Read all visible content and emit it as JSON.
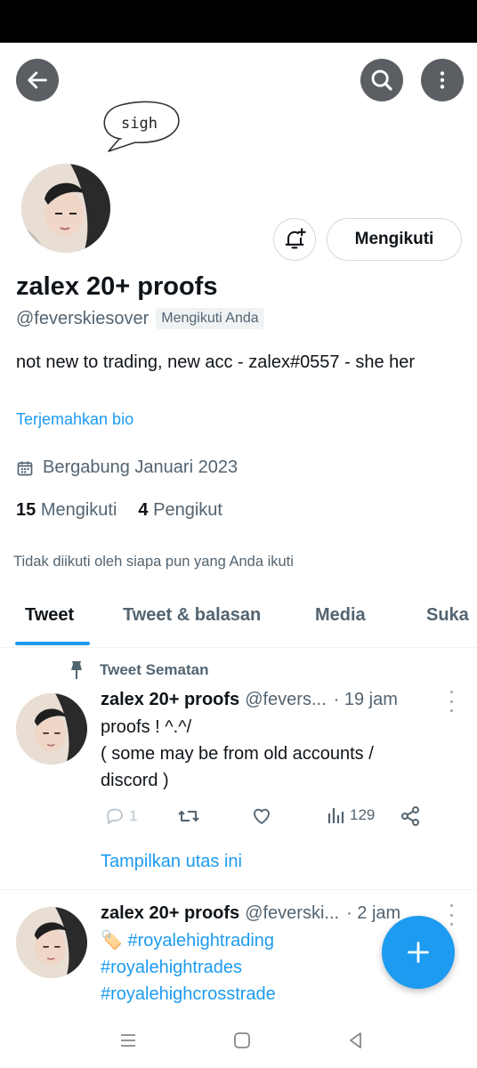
{
  "header": {
    "back_icon": "arrow-left-icon",
    "search_icon": "search-icon",
    "more_icon": "more-vertical-icon"
  },
  "profile": {
    "bubble_text": "sigh",
    "display_name": "zalex 20+ proofs",
    "handle": "@feverskiesover",
    "follows_you_badge": "Mengikuti Anda",
    "follow_button_label": "Mengikuti",
    "notify_icon": "bell-plus-icon",
    "bio": "not new to trading, new acc - zalex#0557 - she her",
    "translate_bio": "Terjemahkan bio",
    "joined": "Bergabung Januari 2023",
    "following_count": "15",
    "following_label": "Mengikuti",
    "followers_count": "4",
    "followers_label": "Pengikut",
    "not_followed_text": "Tidak diikuti oleh siapa pun yang Anda ikuti"
  },
  "tabs": [
    {
      "label": "Tweet",
      "active": true
    },
    {
      "label": "Tweet & balasan",
      "active": false
    },
    {
      "label": "Media",
      "active": false
    },
    {
      "label": "Suka",
      "active": false
    }
  ],
  "tweets": [
    {
      "pinned_label": "Tweet Sematan",
      "name": "zalex 20+ proofs",
      "handle": "@fevers...",
      "time": "· 19 jam",
      "text": "proofs ! ^.^/\n( some may be from old accounts / discord )",
      "reply_count": "1",
      "retweet_count": "",
      "like_count": "",
      "views_count": "129",
      "show_thread": "Tampilkan utas ini"
    },
    {
      "name": "zalex 20+ proofs",
      "handle": "@feverski...",
      "time": "· 2 jam",
      "emoji": "🏷️",
      "hashtags": [
        "#royalehightrading",
        "#royalehightrades",
        "#royalehighcrosstrade"
      ]
    }
  ],
  "fab_icon": "plus-icon",
  "colors": {
    "accent": "#1d9bf0",
    "text_primary": "#0f1419",
    "text_secondary": "#536471",
    "header_button_bg": "#5b5f63"
  }
}
